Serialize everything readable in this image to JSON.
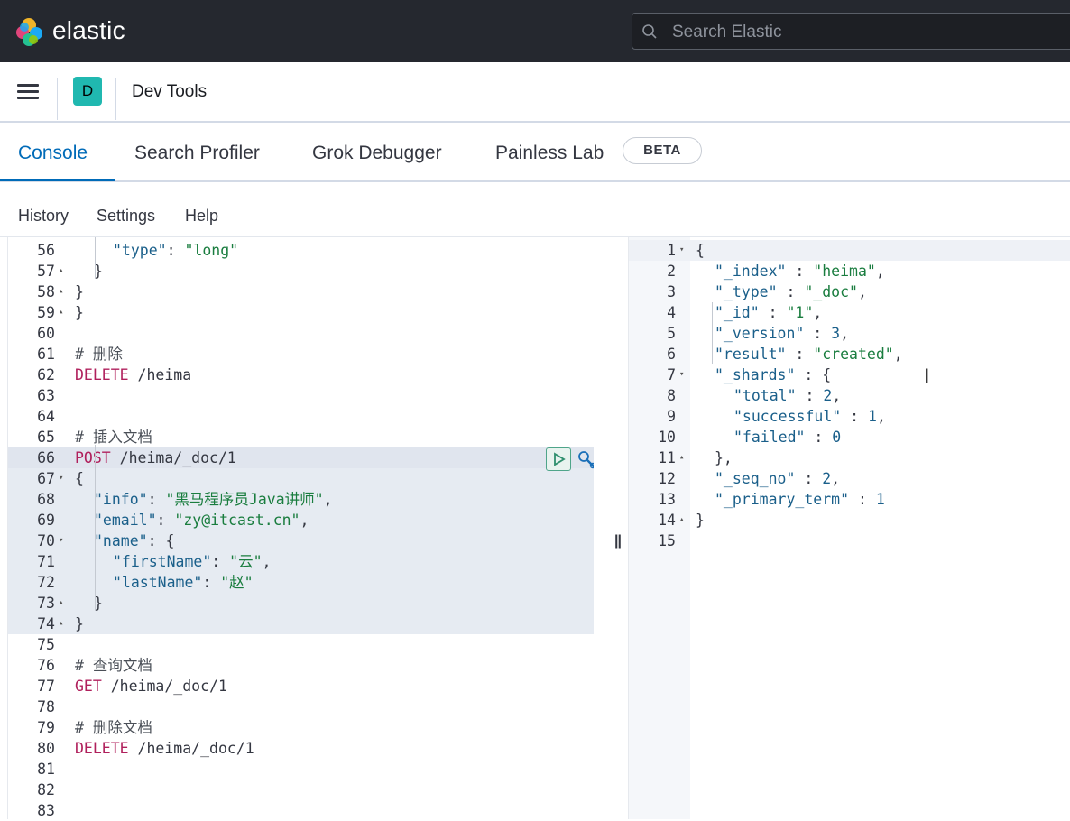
{
  "header": {
    "brand": "elastic",
    "search_placeholder": "Search Elastic",
    "icons": [
      "elastic-logo",
      "search-icon"
    ]
  },
  "appbar": {
    "avatar_letter": "D",
    "title": "Dev Tools",
    "icons": [
      "hamburger-menu-icon"
    ]
  },
  "tabs": [
    {
      "label": "Console",
      "active": true
    },
    {
      "label": "Search Profiler",
      "active": false
    },
    {
      "label": "Grok Debugger",
      "active": false
    },
    {
      "label": "Painless Lab",
      "active": false
    }
  ],
  "beta_badge": "BETA",
  "menu": {
    "history": "History",
    "settings": "Settings",
    "help": "Help"
  },
  "request_editor": {
    "lines": [
      {
        "n": "56",
        "fold": "",
        "code": "\"type\": \"long\""
      },
      {
        "n": "57",
        "fold": "▴",
        "code": "}"
      },
      {
        "n": "58",
        "fold": "▴",
        "code": "}"
      },
      {
        "n": "59",
        "fold": "▴",
        "code": "}"
      },
      {
        "n": "60",
        "fold": "",
        "code": ""
      },
      {
        "n": "61",
        "fold": "",
        "code": "# 删除"
      },
      {
        "n": "62",
        "fold": "",
        "code": "DELETE /heima"
      },
      {
        "n": "63",
        "fold": "",
        "code": ""
      },
      {
        "n": "64",
        "fold": "",
        "code": ""
      },
      {
        "n": "65",
        "fold": "",
        "code": "# 插入文档"
      },
      {
        "n": "66",
        "fold": "",
        "code": "POST /heima/_doc/1"
      },
      {
        "n": "67",
        "fold": "▾",
        "code": "{"
      },
      {
        "n": "68",
        "fold": "",
        "code": "\"info\": \"黑马程序员Java讲师\","
      },
      {
        "n": "69",
        "fold": "",
        "code": "\"email\": \"zy@itcast.cn\","
      },
      {
        "n": "70",
        "fold": "▾",
        "code": "\"name\": {"
      },
      {
        "n": "71",
        "fold": "",
        "code": "\"firstName\": \"云\","
      },
      {
        "n": "72",
        "fold": "",
        "code": "\"lastName\": \"赵\""
      },
      {
        "n": "73",
        "fold": "▴",
        "code": "}"
      },
      {
        "n": "74",
        "fold": "▴",
        "code": "}"
      },
      {
        "n": "75",
        "fold": "",
        "code": ""
      },
      {
        "n": "76",
        "fold": "",
        "code": "# 查询文档"
      },
      {
        "n": "77",
        "fold": "",
        "code": "GET /heima/_doc/1"
      },
      {
        "n": "78",
        "fold": "",
        "code": ""
      },
      {
        "n": "79",
        "fold": "",
        "code": "# 删除文档"
      },
      {
        "n": "80",
        "fold": "",
        "code": "DELETE /heima/_doc/1"
      },
      {
        "n": "81",
        "fold": "",
        "code": ""
      },
      {
        "n": "82",
        "fold": "",
        "code": ""
      },
      {
        "n": "83",
        "fold": "",
        "code": ""
      }
    ],
    "action_icons": [
      "play-icon",
      "wrench-icon"
    ]
  },
  "response_editor": {
    "lines": [
      {
        "n": "1",
        "fold": "▾",
        "code": "{"
      },
      {
        "n": "2",
        "fold": "",
        "code": "\"_index\" : \"heima\","
      },
      {
        "n": "3",
        "fold": "",
        "code": "\"_type\" : \"_doc\","
      },
      {
        "n": "4",
        "fold": "",
        "code": "\"_id\" : \"1\","
      },
      {
        "n": "5",
        "fold": "",
        "code": "\"_version\" : 3,"
      },
      {
        "n": "6",
        "fold": "",
        "code": "\"result\" : \"created\","
      },
      {
        "n": "7",
        "fold": "▾",
        "code": "\"_shards\" : {"
      },
      {
        "n": "8",
        "fold": "",
        "code": "\"total\" : 2,"
      },
      {
        "n": "9",
        "fold": "",
        "code": "\"successful\" : 1,"
      },
      {
        "n": "10",
        "fold": "",
        "code": "\"failed\" : 0"
      },
      {
        "n": "11",
        "fold": "▴",
        "code": "},"
      },
      {
        "n": "12",
        "fold": "",
        "code": "\"_seq_no\" : 2,"
      },
      {
        "n": "13",
        "fold": "",
        "code": "\"_primary_term\" : 1"
      },
      {
        "n": "14",
        "fold": "▴",
        "code": "}"
      },
      {
        "n": "15",
        "fold": "",
        "code": ""
      }
    ]
  },
  "colors": {
    "topbar": "#25282f",
    "accent": "#006bb8",
    "avatar": "#20b8b0",
    "string": "#1a7d3f",
    "keyword": "#b0205c"
  }
}
